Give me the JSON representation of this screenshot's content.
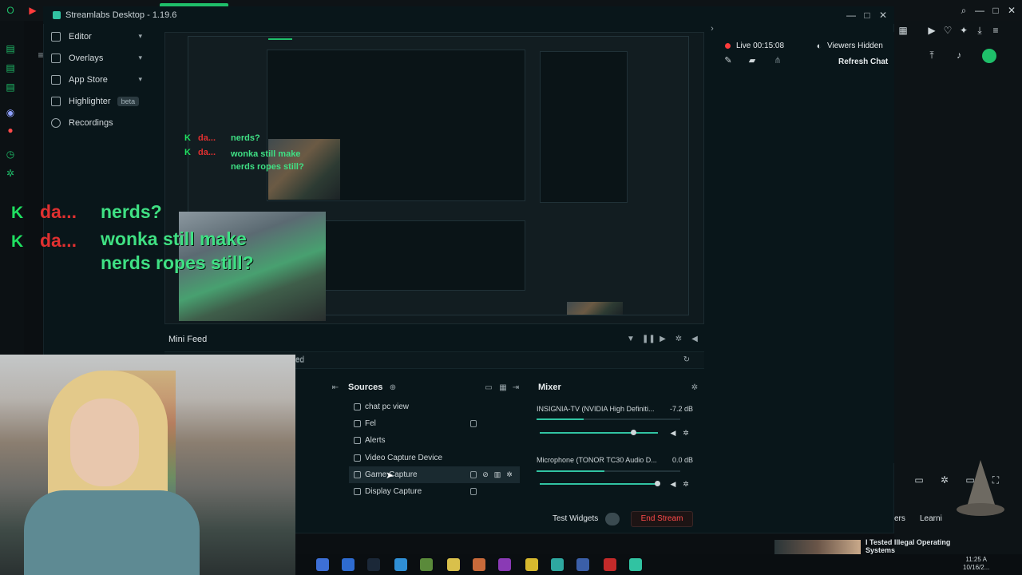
{
  "app": {
    "title": "Streamlabs Desktop - 1.19.6"
  },
  "sidebar": {
    "items": [
      {
        "label": "Editor",
        "icon": "editor-icon",
        "chevron": "▾"
      },
      {
        "label": "Overlays",
        "icon": "overlays-icon",
        "chevron": "▾"
      },
      {
        "label": "App Store",
        "icon": "app-store-icon",
        "chevron": "▾"
      },
      {
        "label": "Highlighter",
        "icon": "highlighter-icon",
        "badge": "beta"
      },
      {
        "label": "Recordings",
        "icon": "recordings-icon"
      }
    ]
  },
  "overlay_chat": [
    {
      "badge": "K",
      "name": "da...",
      "message": "nerds?"
    },
    {
      "badge": "K",
      "name": "da...",
      "message": "wonka still make nerds ropes still?"
    }
  ],
  "nested_chat": [
    {
      "badge": "K",
      "name": "da...",
      "message": "nerds?"
    },
    {
      "badge": "K",
      "name": "da...",
      "message": "wonka still make nerds ropes still?"
    }
  ],
  "mini_feed": {
    "title": "Mini Feed",
    "row_text": "ed"
  },
  "sources": {
    "title": "Sources",
    "items": [
      {
        "label": "chat pc view",
        "icon": "eye-icon",
        "locked": false,
        "selected": false
      },
      {
        "label": "Fel",
        "icon": "eye-icon",
        "locked": true,
        "selected": false
      },
      {
        "label": "Alerts",
        "icon": "eye-icon",
        "locked": false,
        "selected": false
      },
      {
        "label": "Video Capture Device",
        "icon": "eye-icon",
        "locked": false,
        "selected": false
      },
      {
        "label": "Game Capture",
        "icon": "eye-icon",
        "locked": true,
        "selected": true
      },
      {
        "label": "Display Capture",
        "icon": "eye-icon",
        "locked": true,
        "selected": false
      }
    ]
  },
  "mixer": {
    "title": "Mixer",
    "channels": [
      {
        "name": "INSIGNIA-TV (NVIDIA High Definiti...",
        "db": "-7.2 dB",
        "level": 0.33,
        "volume": 0.8
      },
      {
        "name": "Microphone (TONOR TC30 Audio D...",
        "db": "0.0 dB",
        "level": 0.47,
        "volume": 1.0
      }
    ]
  },
  "footer": {
    "test_widgets": "Test Widgets",
    "end_stream": "End Stream"
  },
  "chat_panel": {
    "live": "Live 00:15:08",
    "viewers": "Viewers Hidden",
    "refresh": "Refresh Chat"
  },
  "youtube": {
    "card_title": "I Tested Illegal Operating Systems",
    "learn": "Learni",
    "ers": "ers"
  },
  "clock": {
    "time": "11:25 A",
    "date": "10/16/2..."
  },
  "colors": {
    "accent": "#31c3a2",
    "live": "#ff3b3b",
    "chat_name": "#e03030",
    "chat_msg": "#3fe084",
    "kick": "#1fe060"
  }
}
